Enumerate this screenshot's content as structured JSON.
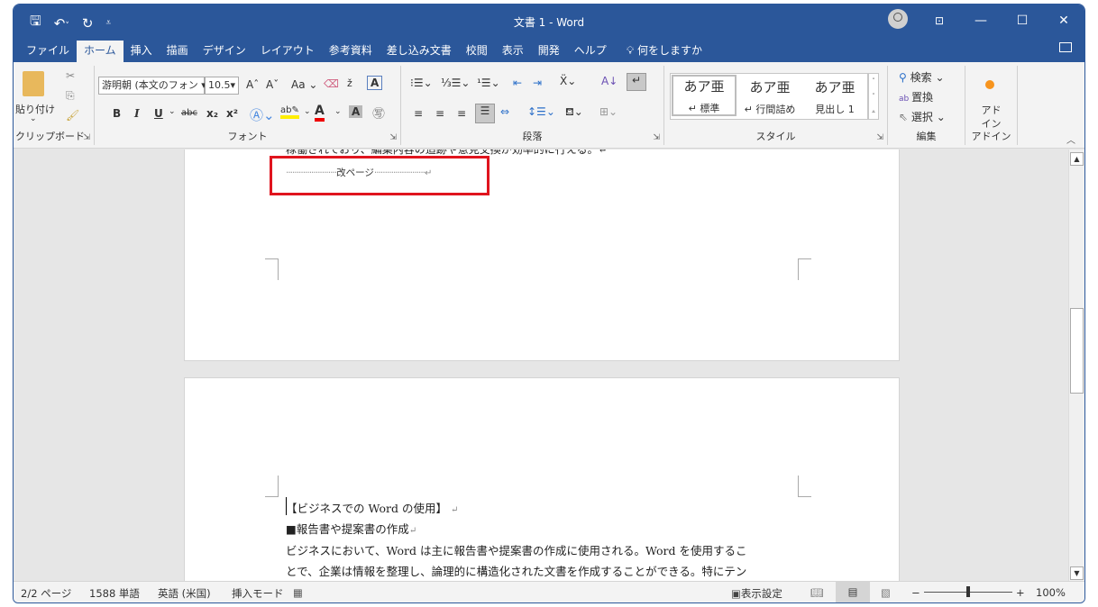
{
  "titlebar": {
    "title": "文書 1  -  Word",
    "qat": {
      "save_icon": "save-icon",
      "undo_icon": "undo-icon",
      "undo_dropdown": "˅",
      "redo_icon": "redo-icon",
      "customize_icon": "customize-qat-icon"
    },
    "controls": {
      "account": "account-avatar",
      "ribbon_display": "ribbon-display-options",
      "minimize": "—",
      "maximize": "☐",
      "close": "✕"
    }
  },
  "tabs": [
    "ファイル",
    "ホーム",
    "挿入",
    "描画",
    "デザイン",
    "レイアウト",
    "参考資料",
    "差し込み文書",
    "校閲",
    "表示",
    "開発",
    "ヘルプ"
  ],
  "active_tab": "ホーム",
  "tell_me": "何をしますか",
  "ribbon": {
    "clipboard": {
      "paste_label": "貼り付け",
      "group_label": "クリップボード"
    },
    "font": {
      "font_name": "游明朝 (本文のフォン",
      "font_size": "10.5",
      "change_case": "Aa",
      "group_label": "フォント"
    },
    "paragraph": {
      "group_label": "段落"
    },
    "styles": {
      "items": [
        {
          "sample": "あア亜",
          "label": "↵ 標準"
        },
        {
          "sample": "あア亜",
          "label": "↵ 行間詰め"
        },
        {
          "sample": "あア亜",
          "label": "見出し 1"
        }
      ],
      "group_label": "スタイル"
    },
    "editing": {
      "find": "検索",
      "replace": "置換",
      "select": "選択",
      "group_label": "編集"
    },
    "addins": {
      "addin_label_1": "アド",
      "addin_label_2": "イン",
      "group_label": "アドイン"
    }
  },
  "document": {
    "clipped_line": "稼働されており、編集内容の追跡や意見交換が効率的に行える。↵",
    "page_break": "改ページ",
    "heading": "【ビジネスでの Word の使用】",
    "subheading": "■報告書や提案書の作成",
    "body_line1": "ビジネスにおいて、Word は主に報告書や提案書の作成に使用される。Word を使用するこ",
    "body_line2": "とで、企業は情報を整理し、論理的に構造化された文書を作成することができる。特にテン",
    "pilcrow": "↵"
  },
  "status": {
    "page": "2/2 ページ",
    "words": "1588 単語",
    "language": "英語 (米国)",
    "mode": "挿入モード",
    "display_settings": "表示設定",
    "zoom_minus": "−",
    "zoom_plus": "+",
    "zoom": "100%",
    "zoom_percent": 100
  },
  "scroll": {
    "position_fraction": 0.45
  },
  "colors": {
    "brand": "#2b579a",
    "highlight_box": "#e0141e"
  }
}
